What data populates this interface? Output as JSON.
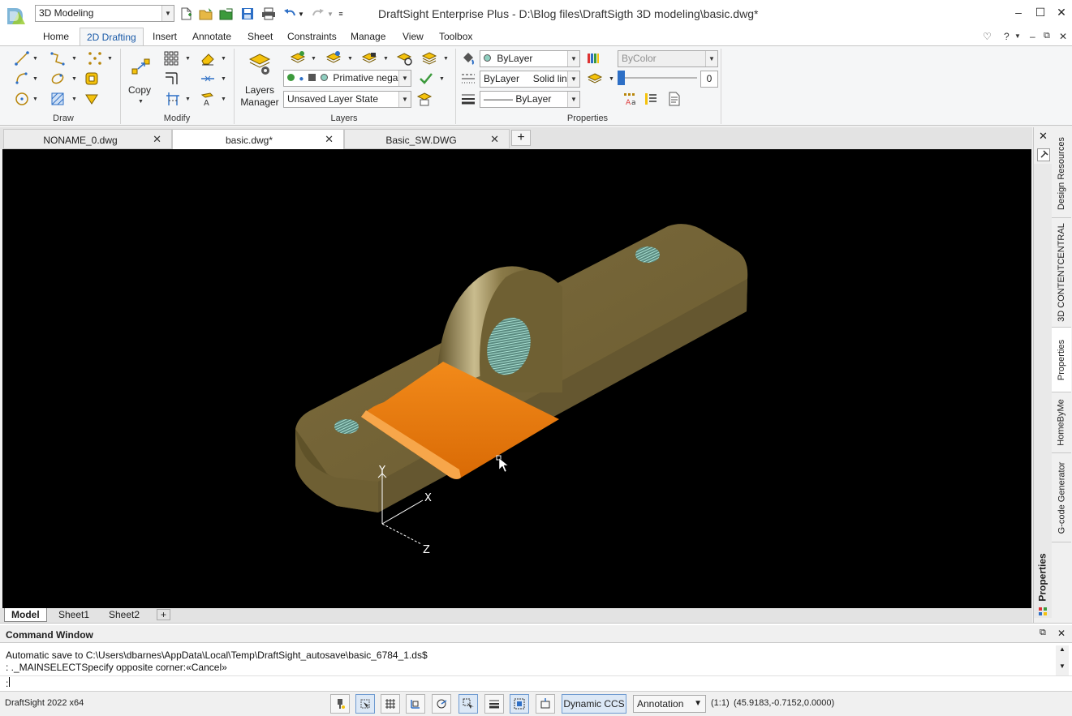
{
  "titlebar": {
    "workspace": "3D Modeling",
    "window_title": "DraftSight Enterprise Plus - D:\\Blog files\\DraftSigth 3D modeling\\basic.dwg*",
    "window_buttons": [
      "–",
      "☐",
      "✕"
    ]
  },
  "ribbon_tabs": [
    "Home",
    "2D Drafting",
    "Insert",
    "Annotate",
    "Sheet",
    "Constraints",
    "Manage",
    "View",
    "Toolbox"
  ],
  "ribbon_tabs_active": "2D Drafting",
  "ribbon": {
    "groups": [
      "Draw",
      "Modify",
      "Layers",
      "Properties"
    ],
    "copy_label": "Copy",
    "layers_manager_label": "Layers Manager",
    "layer_combo": "Primative nega",
    "layer_state_combo": "Unsaved Layer State",
    "color_combo": "ByLayer",
    "linetype_combo": "ByLayer     Solid line",
    "lineweight_combo": "——— ByLayer",
    "plotstyle_combo": "ByColor",
    "transparency_value": "0"
  },
  "doc_tabs": [
    {
      "label": "NONAME_0.dwg",
      "active": false
    },
    {
      "label": "basic.dwg*",
      "active": true
    },
    {
      "label": "Basic_SW.DWG",
      "active": false
    }
  ],
  "sheet_tabs": [
    "Model",
    "Sheet1",
    "Sheet2"
  ],
  "right_panel": {
    "tabs": [
      "Design Resources",
      "3D CONTENTCENTRAL",
      "Properties",
      "HomeByMe",
      "G-code Generator"
    ],
    "palette_title": "Properties"
  },
  "canvas": {
    "ucs_labels": {
      "y": "Y",
      "x": "X",
      "z": "Z"
    },
    "colors": {
      "background": "#000000",
      "body": "#7b6a3b",
      "selected_face": "#e8780a",
      "hatch": "#8fcfc0"
    }
  },
  "command_window": {
    "title": "Command Window",
    "lines": [
      "Automatic save to C:\\Users\\dbarnes\\AppData\\Local\\Temp\\DraftSight_autosave\\basic_6784_1.ds$",
      ": ._MAINSELECTSpecify opposite corner:«Cancel»",
      ":"
    ]
  },
  "statusbar": {
    "app_version": "DraftSight 2022 x64",
    "dynamic_ccs": "Dynamic CCS",
    "annotation": "Annotation",
    "scale": "(1:1)",
    "coordinates": "(45.9183,-0.7152,0.0000)"
  }
}
